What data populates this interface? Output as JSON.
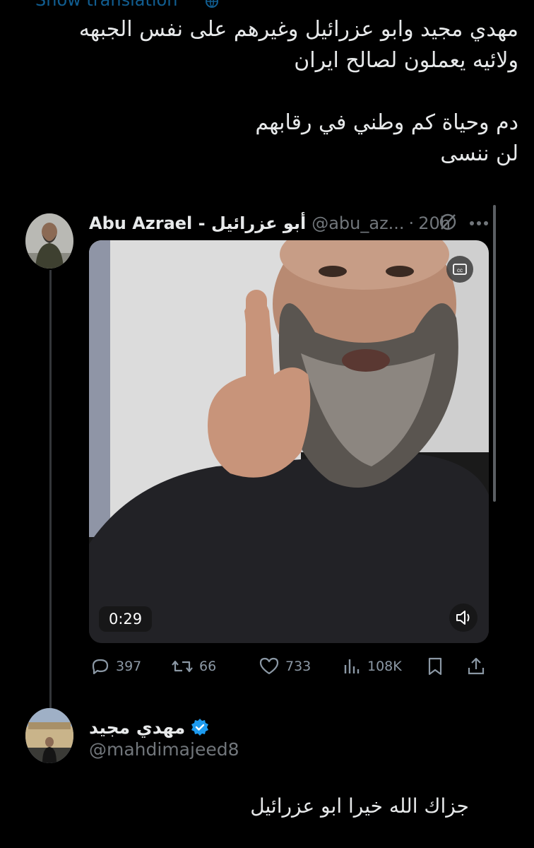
{
  "translation_link": "Show translation",
  "main_tweet": {
    "text": "مهدي مجيد وابو عزرائيل وغيرهم على نفس الجبهه\nولائيه يعملون لصالح ايران\n\nدم وحياة كم وطني في رقابهم\nلن ننسى"
  },
  "quoted_tweet": {
    "author_name": "Abu Azrael - أبو عزرائيل",
    "handle": "@abu_az...",
    "separator": "·",
    "time": "20h",
    "video_duration": "0:29",
    "stats": {
      "replies": "397",
      "retweets": "66",
      "likes": "733",
      "views": "108K"
    }
  },
  "reply": {
    "author_name": "مهدي مجيد",
    "handle": "@mahdimajeed8",
    "text": "جزاك الله خيرا ابو عزرائيل"
  },
  "colors": {
    "background": "#000000",
    "text": "#e7e9ea",
    "secondary": "#71767b",
    "accent": "#1d9bf0"
  },
  "icons": [
    "globe-icon",
    "grok-icon",
    "more-icon",
    "cc-icon",
    "volume-icon",
    "reply-icon",
    "retweet-icon",
    "like-icon",
    "views-icon",
    "bookmark-icon",
    "share-icon",
    "verified-icon"
  ]
}
